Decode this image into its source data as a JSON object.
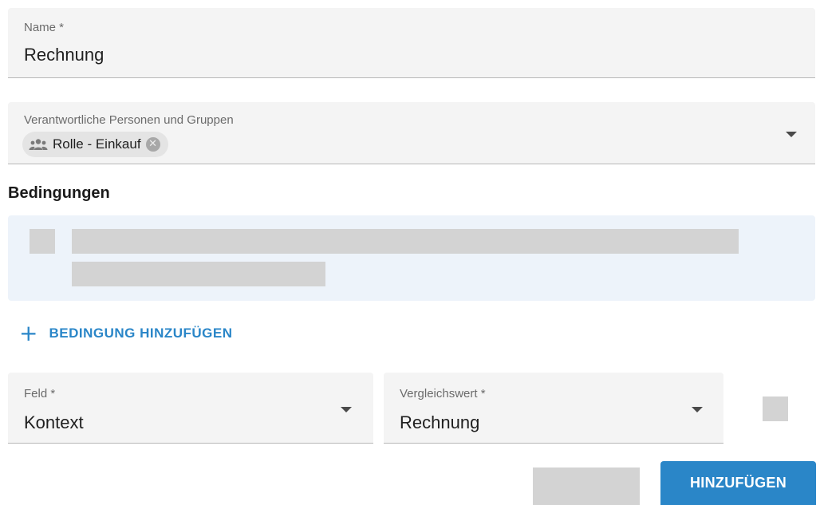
{
  "name_field": {
    "label": "Name *",
    "value": "Rechnung"
  },
  "persons_field": {
    "label": "Verantwortliche Personen und Gruppen",
    "chips": [
      {
        "label": "Rolle - Einkauf",
        "icon": "group-icon",
        "remove_icon": "chip-remove-icon"
      }
    ]
  },
  "conditions": {
    "title": "Bedingungen",
    "add_label": "BEDINGUNG HINZUFÜGEN",
    "add_icon": "+"
  },
  "feld_field": {
    "label": "Feld *",
    "value": "Kontext"
  },
  "vergleichswert_field": {
    "label": "Vergleichswert *",
    "value": "Rechnung"
  },
  "actions": {
    "submit_label": "HINZUFÜGEN"
  },
  "colors": {
    "accent": "#2a86c8",
    "panel": "#edf3fa",
    "skeleton": "#d3d3d3"
  }
}
